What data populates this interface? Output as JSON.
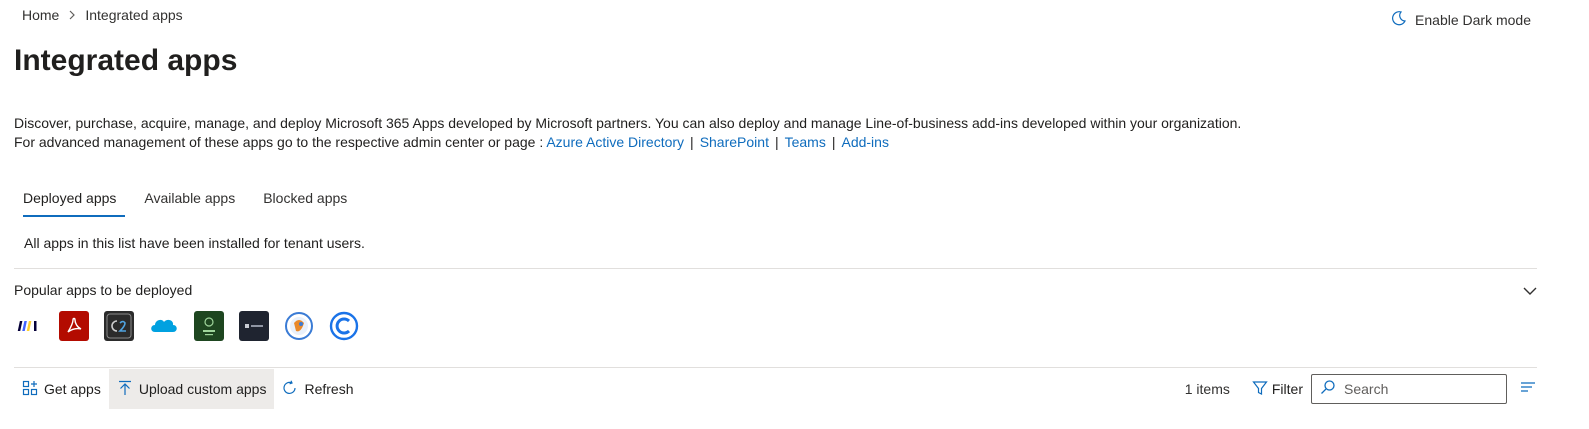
{
  "breadcrumb": {
    "home": "Home",
    "current": "Integrated apps"
  },
  "header": {
    "dark_mode_label": "Enable Dark mode"
  },
  "page": {
    "title": "Integrated apps",
    "description_line1": "Discover, purchase, acquire, manage, and deploy Microsoft 365 Apps developed by Microsoft partners. You can also deploy and manage Line-of-business add-ins developed within your organization.",
    "description_line2_prefix": "For advanced management of these apps go to the respective admin center or page : ",
    "links": [
      "Azure Active Directory",
      "SharePoint",
      "Teams",
      "Add-ins"
    ],
    "link_separator": "|"
  },
  "tabs": [
    {
      "label": "Deployed apps",
      "active": true
    },
    {
      "label": "Available apps",
      "active": false
    },
    {
      "label": "Blocked apps",
      "active": false
    }
  ],
  "tab_note": "All apps in this list have been installed for tenant users.",
  "popular": {
    "title": "Popular apps to be deployed",
    "apps": [
      {
        "icon": "miro-icon"
      },
      {
        "icon": "adobe-acrobat-icon",
        "color": "#b30b00"
      },
      {
        "icon": "c2-icon",
        "color": "#2b2b2b"
      },
      {
        "icon": "salesforce-icon",
        "color": "#00a1e0"
      },
      {
        "icon": "flamingo-icon",
        "color": "#1e4620"
      },
      {
        "icon": "dark-app-icon",
        "color": "#1f2430"
      },
      {
        "icon": "globe-app-icon",
        "color": "#3a7bd5"
      },
      {
        "icon": "blue-c-icon",
        "color": "#1a73e8"
      }
    ]
  },
  "toolbar": {
    "get_apps": "Get apps",
    "upload": "Upload custom apps",
    "refresh": "Refresh",
    "count": "1 items",
    "filter": "Filter",
    "search_placeholder": "Search"
  },
  "colors": {
    "accent": "#0f6cbd",
    "text": "#201f1e",
    "divider": "#e1dfdd"
  }
}
